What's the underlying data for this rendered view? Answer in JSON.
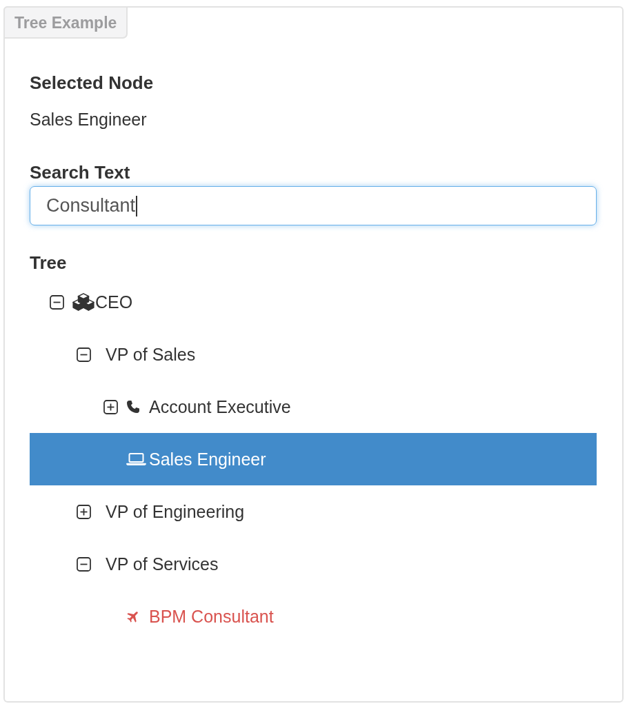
{
  "panel": {
    "title": "Tree Example"
  },
  "selected_node": {
    "label": "Selected Node",
    "value": "Sales Engineer"
  },
  "search": {
    "label": "Search Text",
    "value": "Consultant",
    "focused": true
  },
  "tree": {
    "label": "Tree",
    "nodes": [
      {
        "text": "CEO",
        "kind": "cubes",
        "expanded": true,
        "selected": false,
        "matched": false,
        "children": [
          {
            "text": "VP of Sales",
            "kind": "plain",
            "expanded": true,
            "selected": false,
            "matched": false,
            "children": [
              {
                "text": "Account Executive",
                "kind": "phone",
                "expanded": false,
                "selected": false,
                "matched": false
              },
              {
                "text": "Sales Engineer",
                "kind": "laptop",
                "selected": true,
                "matched": false
              }
            ]
          },
          {
            "text": "VP of Engineering",
            "kind": "plain",
            "expanded": false,
            "selected": false,
            "matched": false
          },
          {
            "text": "VP of Services",
            "kind": "plain",
            "expanded": true,
            "selected": false,
            "matched": false,
            "children": [
              {
                "text": "BPM Consultant",
                "kind": "plane",
                "selected": false,
                "matched": true
              }
            ]
          }
        ]
      }
    ]
  }
}
